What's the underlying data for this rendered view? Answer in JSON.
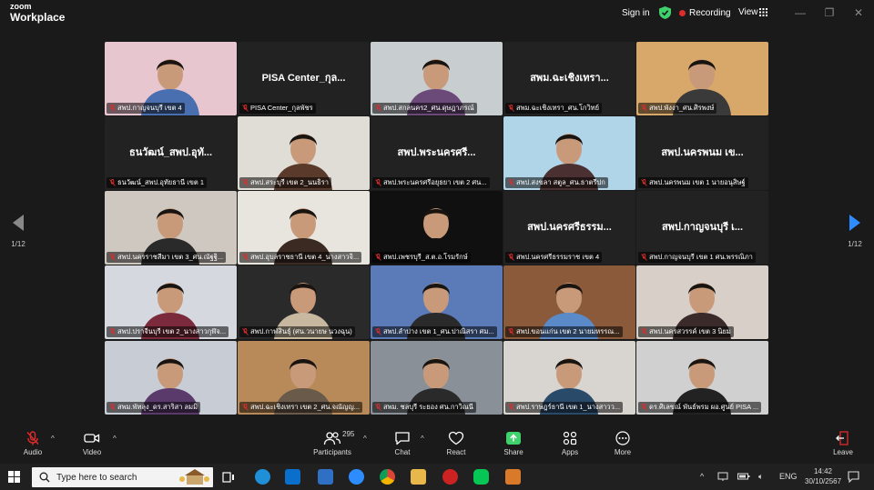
{
  "app": {
    "logo_top": "zoom",
    "logo_bottom": "Workplace"
  },
  "topbar": {
    "signin": "Sign in",
    "recording": "Recording",
    "view": "View"
  },
  "nav": {
    "page_left": "1/12",
    "page_right": "1/12"
  },
  "tiles": [
    {
      "label": "สพป.กาญจนบุรี เขต 4",
      "big": ""
    },
    {
      "label": "PISA Center_กุลพัชร",
      "big": "PISA  Center_กุล..."
    },
    {
      "label": "สพป.สกลนคร2_ศน.ดุษฎาภรณ์",
      "big": ""
    },
    {
      "label": "สพม.ฉะเชิงเทรา_ศน.โกวิทย์",
      "big": "สพม.ฉะเชิงเทรา..."
    },
    {
      "label": "สพป.พังงา_ศน.ศิรพงษ์",
      "big": ""
    },
    {
      "label": "ธนวัฒน์_สพป.อุทัยธานี เขต 1",
      "big": "ธนวัฒน์_สพป.อุทั..."
    },
    {
      "label": "สพป.สระบุรี เขต 2_นนธิรา",
      "big": ""
    },
    {
      "label": "สพป.พระนครศรีอยุธยา เขต 2 ศน...",
      "big": "สพป.พระนครศรี..."
    },
    {
      "label": "สพป.สงขลา สตูล_ศน.ธาตรีปก",
      "big": ""
    },
    {
      "label": "สพป.นครพนม เขต 1 นายอนุสิษฐ์",
      "big": "สพป.นครพนม เข..."
    },
    {
      "label": "สพป.นครราชสีมา เขต 3_ศน.ณัฐฐิ...",
      "big": ""
    },
    {
      "label": "สพป.อุบลราชธานี เขต 4_นางสาวจิ...",
      "big": ""
    },
    {
      "label": "สพป.เพชรบุรี_ส.ต.อ.โรมรักษ์",
      "big": ""
    },
    {
      "label": "สพป.นครศรีธรรมราช เขต 4",
      "big": "สพป.นครศรีธรรม..."
    },
    {
      "label": "สพป.กาญจนบุรี เขต 1 ศน.พรรณิภา",
      "big": "สพป.กาญจนบุรี เ..."
    },
    {
      "label": "สพป.ปราจีนบุรี เขต 2_นางสาวกุฬัจ...",
      "big": ""
    },
    {
      "label": "สพป.กาฬสินธุ์ (ศน.วนายษ นวงฉุน)",
      "big": ""
    },
    {
      "label": "สพป.ลำปาง เขต 1_ศน.ปาณิสรา ศม...",
      "big": ""
    },
    {
      "label": "สพป.ขอนแก่น เขต 2 นายมหรรณ...",
      "big": ""
    },
    {
      "label": "สพป.นครสวรรค์ เขต 3 นิยม",
      "big": ""
    },
    {
      "label": "สพม.พัทลุง_ดร.สาริสา ลมมิ",
      "big": ""
    },
    {
      "label": "สพป.ฉะเชิงเทรา เขต 2_ศน.จณัญญ...",
      "big": ""
    },
    {
      "label": "สพม. ชลบุรี ระยอง ศน.กาวิณนี",
      "big": ""
    },
    {
      "label": "สพป.ราษฎร์ธานี เขต 1_นางสาวว...",
      "big": ""
    },
    {
      "label": "ดร.ศิเลขณ์ พันธ์พรม ผอ.ศูนย์ PISA ...",
      "big": ""
    }
  ],
  "toolbar": {
    "audio": "Audio",
    "video": "Video",
    "participants": "Participants",
    "participant_count": "295",
    "chat": "Chat",
    "react": "React",
    "share": "Share",
    "apps": "Apps",
    "more": "More",
    "leave": "Leave"
  },
  "taskbar": {
    "search_placeholder": "Type here to search",
    "lang": "ENG",
    "time": "14:42",
    "date": "30/10/2567"
  },
  "colors": {
    "share_green": "#3fd16b",
    "leave_red": "#e02b2b",
    "accent_blue": "#2d8cff"
  }
}
